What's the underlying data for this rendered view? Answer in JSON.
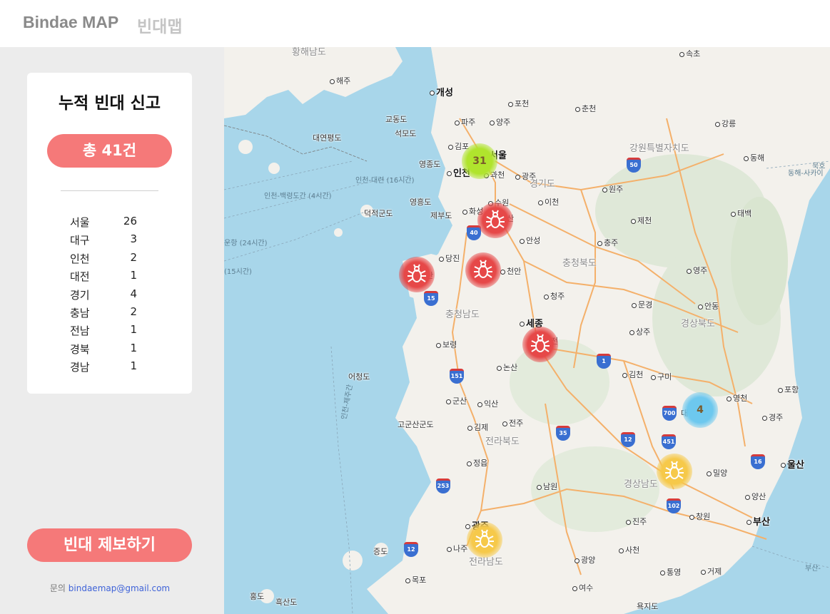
{
  "header": {
    "brand_en": "Bindae MAP",
    "brand_ko": "빈대맵"
  },
  "sidebar": {
    "card_title": "누적 빈대 신고",
    "total_label": "총 41건",
    "regions": [
      {
        "name": "서울",
        "count": "26"
      },
      {
        "name": "대구",
        "count": "3"
      },
      {
        "name": "인천",
        "count": "2"
      },
      {
        "name": "대전",
        "count": "1"
      },
      {
        "name": "경기",
        "count": "4"
      },
      {
        "name": "충남",
        "count": "2"
      },
      {
        "name": "전남",
        "count": "1"
      },
      {
        "name": "경북",
        "count": "1"
      },
      {
        "name": "경남",
        "count": "1"
      }
    ],
    "report_button": "빈대 제보하기",
    "contact_prefix": "문의",
    "contact_email": "bindaemap@gmail.com"
  },
  "map": {
    "labels": {
      "hwanghae": "황해남도",
      "sokcho": "속초",
      "haeju": "해주",
      "kaesong": "개성",
      "pocheon": "포천",
      "chuncheon": "춘천",
      "gangneung": "강릉",
      "gyodong": "교동도",
      "paju": "파주",
      "yangju": "양주",
      "seokmo": "석모도",
      "yeonpyeong": "대연평도",
      "gimpo": "김포",
      "seoul": "서울",
      "gangwon": "강원특별자치도",
      "donghae": "동해",
      "yeongjong": "영종도",
      "incheon": "인천",
      "gwacheon": "과천",
      "gwangju_gg": "광주",
      "incheon_daeyeon": "인천-대련 (16시간)",
      "incheon_baengnyeong": "인천-백령도간 (4시간)",
      "gyeonggi": "경기도",
      "wonju": "원주",
      "yeongheung": "영흥도",
      "suwon": "수원",
      "icheon": "이천",
      "deokjeok": "덕적군도",
      "jebu": "제부도",
      "hwaseong": "화성",
      "asan_partial": "산",
      "taebaek": "태백",
      "jecheon": "제천",
      "unhang": "운항 (24시간)",
      "anseong": "안성",
      "chungju": "충주",
      "dangjin": "당진",
      "chungbuk": "충청북도",
      "seosan": "산",
      "cheonan": "천안",
      "yeongju": "영주",
      "fifteen_h": "(15시간)",
      "cheongju": "청주",
      "mungyeong": "문경",
      "andong": "안동",
      "chungnam": "충청남도",
      "sejong": "세종",
      "gyeongbuk": "경상북도",
      "sangju": "상주",
      "daejeon_partial": "전",
      "boryeong": "보령",
      "gimcheon": "김천",
      "gumi": "구미",
      "eocheong": "어청도",
      "nonsan": "논산",
      "incheon_jeju": "인천-제주간",
      "pohang": "포항",
      "yeongcheon": "영천",
      "gunsan": "군산",
      "iksan": "익산",
      "daegu_partial": "대구",
      "gyeongju": "경주",
      "gogunsan": "고군산군도",
      "gimje": "김제",
      "jeonju": "전주",
      "jeonbuk": "전라북도",
      "ulsan": "울산",
      "jeongeup": "정읍",
      "miryang": "밀양",
      "gyeongnam": "경상남도",
      "namwon": "남원",
      "yangsan": "양산",
      "changwon": "창원",
      "busan": "부산",
      "gwangju": "광주",
      "jinju": "진주",
      "jeungdo": "증도",
      "naju": "나주",
      "jeonnam": "전라남도",
      "sacheon": "사천",
      "gwangyang": "광양",
      "tongyeong": "통영",
      "geoje": "거제",
      "mokpo": "목포",
      "busan_ferry": "부산-",
      "hongdo": "홍도",
      "heuksan": "흑산도",
      "yeosu": "여수",
      "yokji": "욕지도",
      "donghae_sakai": "동해-사카이",
      "mukho": "묵호"
    },
    "shields": [
      "50",
      "40",
      "15",
      "151",
      "1",
      "700",
      "35",
      "12",
      "451",
      "16",
      "253",
      "102",
      "12"
    ],
    "markers": [
      {
        "type": "cluster",
        "color": "green",
        "count": "31"
      },
      {
        "type": "cluster",
        "color": "blue",
        "count": "4"
      },
      {
        "type": "bug",
        "color": "red"
      },
      {
        "type": "bug",
        "color": "red"
      },
      {
        "type": "bug",
        "color": "red"
      },
      {
        "type": "bug",
        "color": "red"
      },
      {
        "type": "bug",
        "color": "yellow"
      },
      {
        "type": "bug",
        "color": "yellow"
      }
    ]
  },
  "colors": {
    "accent": "#f57979",
    "sidebar_bg": "#ececec",
    "sea": "#a8d6ea",
    "land": "#f3f1ec",
    "road": "#f4b06a"
  }
}
